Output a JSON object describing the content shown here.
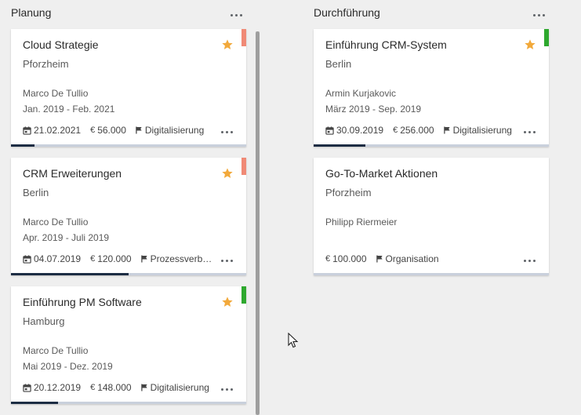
{
  "columns": [
    {
      "title": "Planung",
      "cards": [
        {
          "title": "Cloud Strategie",
          "city": "Pforzheim",
          "person": "Marco De Tullio",
          "period": "Jan. 2019 - Feb. 2021",
          "date": "21.02.2021",
          "amount": "56.000",
          "tag": "Digitalisierung",
          "starred": true,
          "flag_color": "#f08a76",
          "progress": 0.1
        },
        {
          "title": "CRM Erweiterungen",
          "city": "Berlin",
          "person": "Marco De Tullio",
          "period": "Apr. 2019 - Juli 2019",
          "date": "04.07.2019",
          "amount": "120.000",
          "tag": "Prozessverbe…",
          "starred": true,
          "flag_color": "#f08a76",
          "progress": 0.5
        },
        {
          "title": "Einführung PM Software",
          "city": "Hamburg",
          "person": "Marco De Tullio",
          "period": "Mai 2019 - Dez. 2019",
          "date": "20.12.2019",
          "amount": "148.000",
          "tag": "Digitalisierung",
          "starred": true,
          "flag_color": "#2ea82e",
          "progress": 0.2
        }
      ]
    },
    {
      "title": "Durchführung",
      "cards": [
        {
          "title": "Einführung CRM-System",
          "city": "Berlin",
          "person": "Armin Kurjakovic",
          "period": "März 2019 - Sep. 2019",
          "date": "30.09.2019",
          "amount": "256.000",
          "tag": "Digitalisierung",
          "starred": true,
          "flag_color": "#2ea82e",
          "progress": 0.22
        },
        {
          "title": "Go-To-Market Aktionen",
          "city": "Pforzheim",
          "person": "Philipp Riermeier",
          "period": "",
          "date": "",
          "amount": "100.000",
          "tag": "Organisation",
          "starred": false,
          "flag_color": "",
          "progress": 0
        }
      ]
    }
  ],
  "colors": {
    "star": "#f2a93b",
    "progress_fill": "#1d2d44",
    "progress_track": "#c9d0dc"
  },
  "icons": {
    "column_menu": "more-horizontal-icon",
    "star": "star-icon",
    "calendar": "calendar-icon",
    "currency": "euro-icon",
    "tag": "flag-icon",
    "card_menu": "more-horizontal-icon"
  }
}
